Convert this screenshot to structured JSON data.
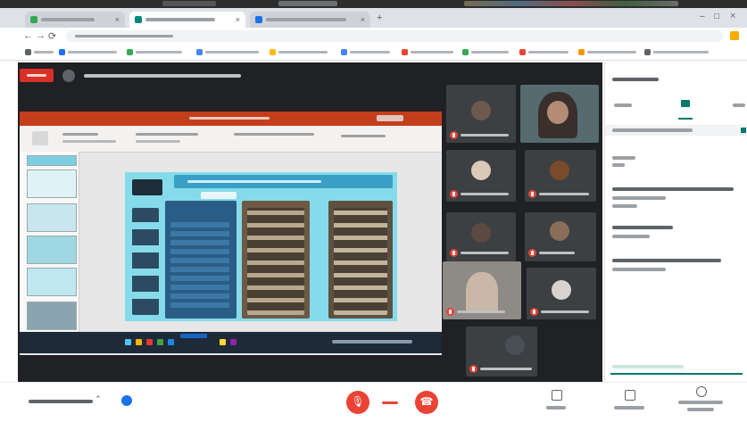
{
  "colors": {
    "stage_bg": "#202124",
    "live_badge": "#d93025",
    "ppt_titlebar": "#c43e1c",
    "slide_bg": "#86dbea",
    "mic_off": "#ea4335",
    "panel_accent": "#00796b",
    "action_button": "#ea4335"
  },
  "icons": {
    "back": "arrow-left-icon",
    "forward": "arrow-right-icon",
    "reload": "reload-icon",
    "mic": "mic-off-icon",
    "hangup": "call-end-icon",
    "camera": "camera-off-icon",
    "present": "present-icon",
    "captions": "captions-icon",
    "more": "more-icon"
  },
  "browser": {
    "tab_close": "×",
    "new_tab": "+",
    "win_min": "–",
    "win_max": "□",
    "win_close": "×",
    "back": "←",
    "forward": "→",
    "reload": "⟳"
  },
  "controls": {
    "mic_glyph": "🎙",
    "hangup_glyph": "☎",
    "expand_glyph": "⌃"
  },
  "participants": [
    {
      "camera_on": false,
      "muted": true
    },
    {
      "camera_on": true,
      "muted": false
    },
    {
      "camera_on": false,
      "muted": true
    },
    {
      "camera_on": false,
      "muted": true
    },
    {
      "camera_on": false,
      "muted": true
    },
    {
      "camera_on": false,
      "muted": true
    },
    {
      "camera_on": true,
      "muted": true
    },
    {
      "camera_on": false,
      "muted": true
    },
    {
      "camera_on": false,
      "muted": true
    }
  ]
}
